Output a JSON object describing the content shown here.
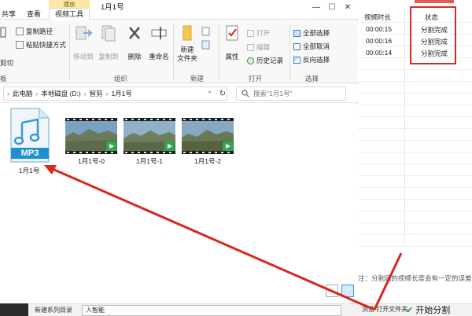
{
  "background_app": {
    "columns": [
      "视频时长",
      "状态"
    ],
    "rows": [
      {
        "duration": "00:00:15",
        "status": "分割完成"
      },
      {
        "duration": "00:00:16",
        "status": "分割完成"
      },
      {
        "duration": "00:00:14",
        "status": "分割完成"
      }
    ],
    "hint": "注：分割后的视频长度会有一定的误差。",
    "footer_label": "新建系列目录",
    "footer_input": "人智能",
    "footer_button": "浏览  打开文件夹",
    "start_button": "开始分割",
    "accent_color": "#d9281d"
  },
  "explorer": {
    "tabs": [
      "共享",
      "查看"
    ],
    "context_group": "播放",
    "context_tab": "视频工具",
    "title": "1月1号",
    "ribbon": {
      "clipboard_partial": {
        "copy_path": "复制路径",
        "paste_shortcut": "粘贴快捷方式",
        "cut": "剪切",
        "group": "板"
      },
      "organize": {
        "move_to": "移动到",
        "copy_to": "复制到",
        "delete": "删除",
        "rename": "重命名",
        "group": "组织"
      },
      "new": {
        "new_folder": "新建\n文件夹",
        "group": "新建"
      },
      "open": {
        "properties": "属性",
        "open": "打开",
        "edit": "编辑",
        "history": "历史记录",
        "group": "打开"
      },
      "select": {
        "select_all": "全部选择",
        "select_none": "全部取消",
        "invert": "反向选择",
        "group": "选择"
      }
    },
    "breadcrumb": [
      "此电脑",
      "本地磁盘 (D:)",
      "智剪",
      "1月1号"
    ],
    "search_placeholder": "搜索\"1月1号\"",
    "files": [
      {
        "name": "1月1号",
        "type": "MP3"
      },
      {
        "name": "1月1号-0",
        "type": "video"
      },
      {
        "name": "1月1号-1",
        "type": "video"
      },
      {
        "name": "1月1号-2",
        "type": "video"
      }
    ]
  }
}
